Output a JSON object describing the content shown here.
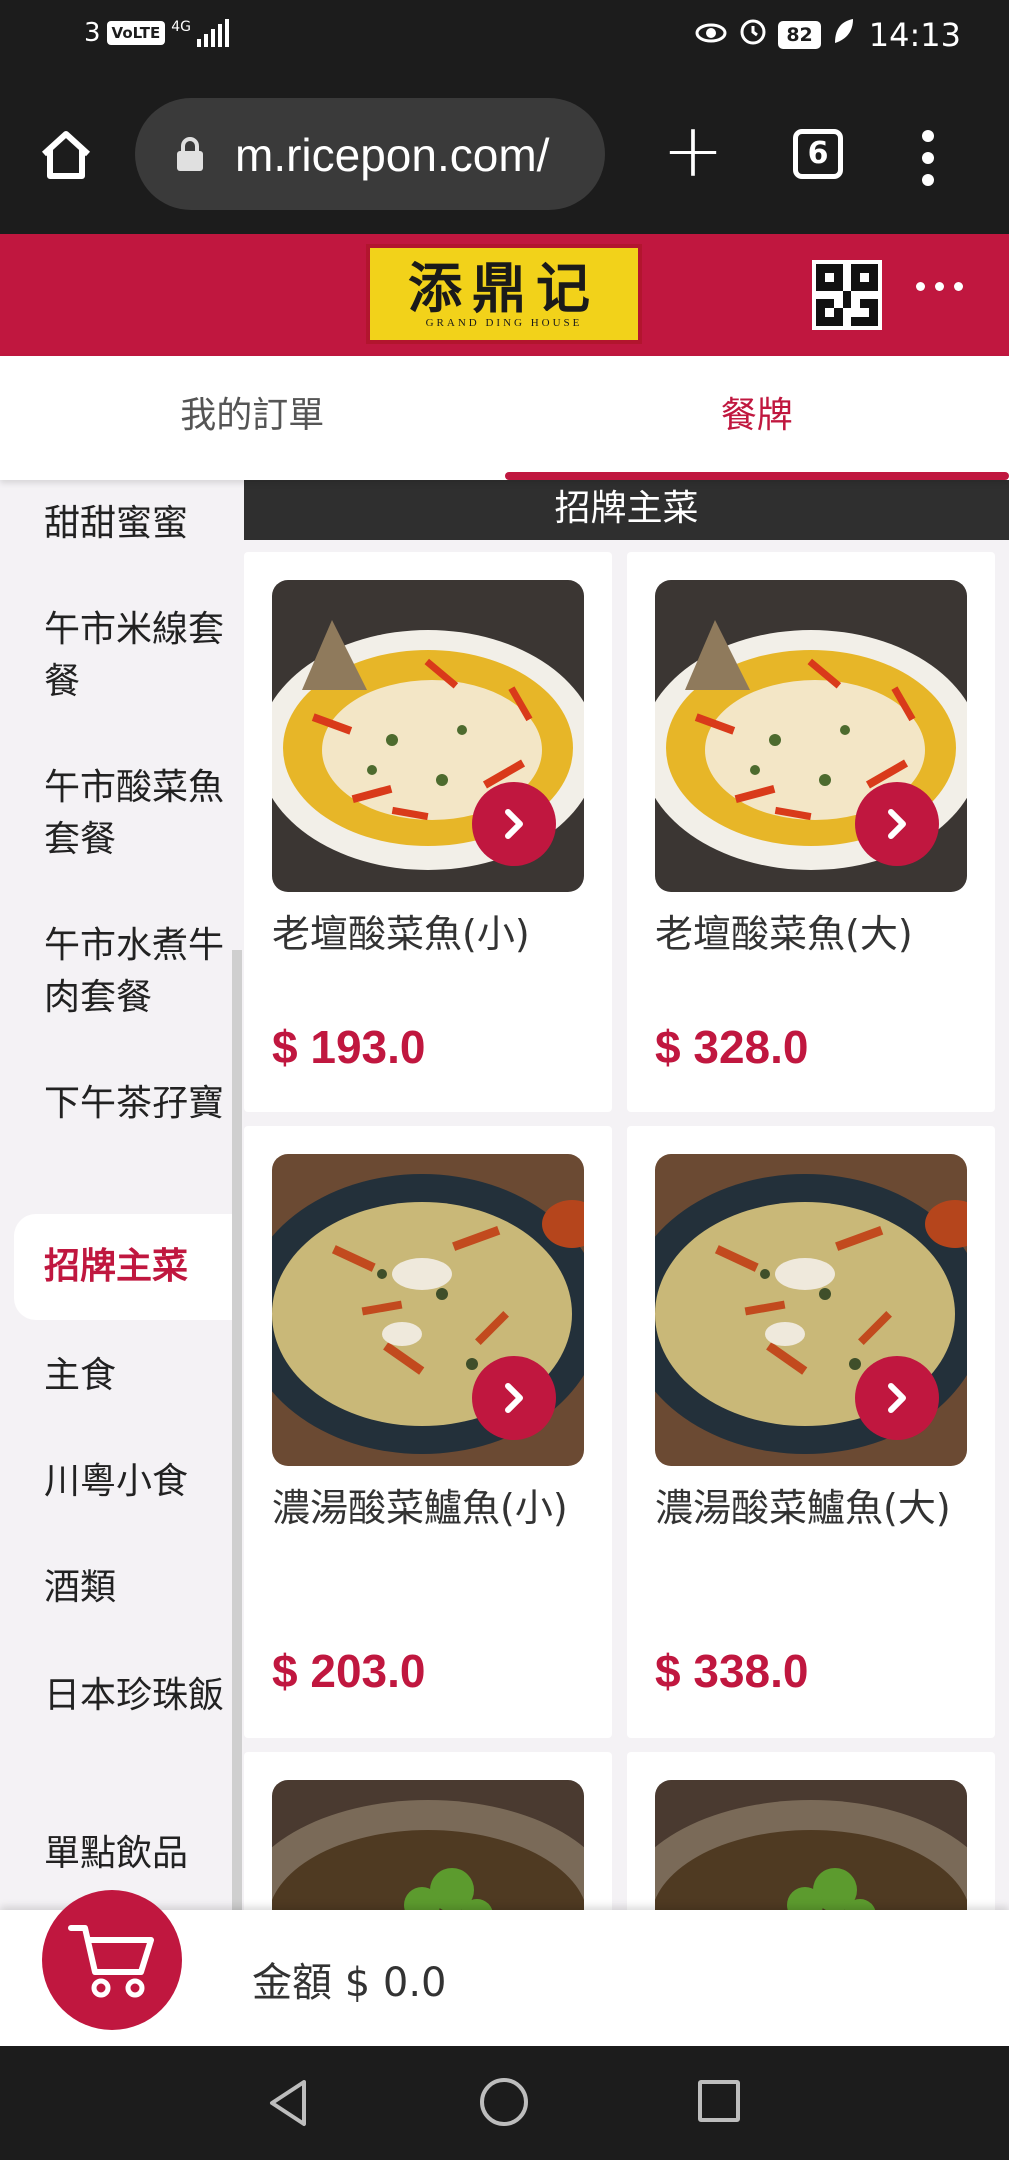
{
  "status_bar": {
    "sim": "3",
    "volte": "VoLTE",
    "network": "4G",
    "battery": "82",
    "time": "14:13",
    "icons": [
      "eye-comfort-icon",
      "alarm-icon",
      "battery-icon",
      "leaf-icon"
    ]
  },
  "browser": {
    "url": "m.ricepon.com/",
    "tab_count": "6",
    "icons": [
      "home-icon",
      "lock-icon",
      "new-tab-icon",
      "menu-icon"
    ]
  },
  "site_header": {
    "logo_text": "添鼎记",
    "logo_subtext": "GRAND DING HOUSE",
    "brand_color": "#c0173f",
    "logo_color": "#f2d21a"
  },
  "tabs": [
    {
      "label": "我的訂單",
      "active": false
    },
    {
      "label": "餐牌",
      "active": true
    }
  ],
  "sidebar": {
    "items": [
      {
        "label": "甜甜蜜蜜"
      },
      {
        "label": "午市米線套餐"
      },
      {
        "label": "午市酸菜魚套餐"
      },
      {
        "label": "午市水煮牛肉套餐"
      },
      {
        "label": "下午茶孖寶"
      },
      {
        "label": "招牌主菜",
        "active": true
      },
      {
        "label": "主食"
      },
      {
        "label": "川粵小食"
      },
      {
        "label": "酒類"
      },
      {
        "label": "日本珍珠飯"
      },
      {
        "label": "單點飲品"
      }
    ]
  },
  "menu": {
    "category_title": "招牌主菜",
    "items": [
      {
        "name": "老壇酸菜魚(小)",
        "price": "$ 193.0",
        "image": "fish-plate"
      },
      {
        "name": "老壇酸菜魚(大)",
        "price": "$ 328.0",
        "image": "fish-plate"
      },
      {
        "name": "濃湯酸菜鱸魚(小)",
        "price": "$ 203.0",
        "image": "soup-bowl"
      },
      {
        "name": "濃湯酸菜鱸魚(大)",
        "price": "$ 338.0",
        "image": "soup-bowl"
      }
    ]
  },
  "cart": {
    "amount_label": "金額 $ 0.0",
    "icon": "cart-icon"
  },
  "nav_bar": {
    "icons": [
      "back-icon",
      "home-circle-icon",
      "recents-icon"
    ]
  }
}
